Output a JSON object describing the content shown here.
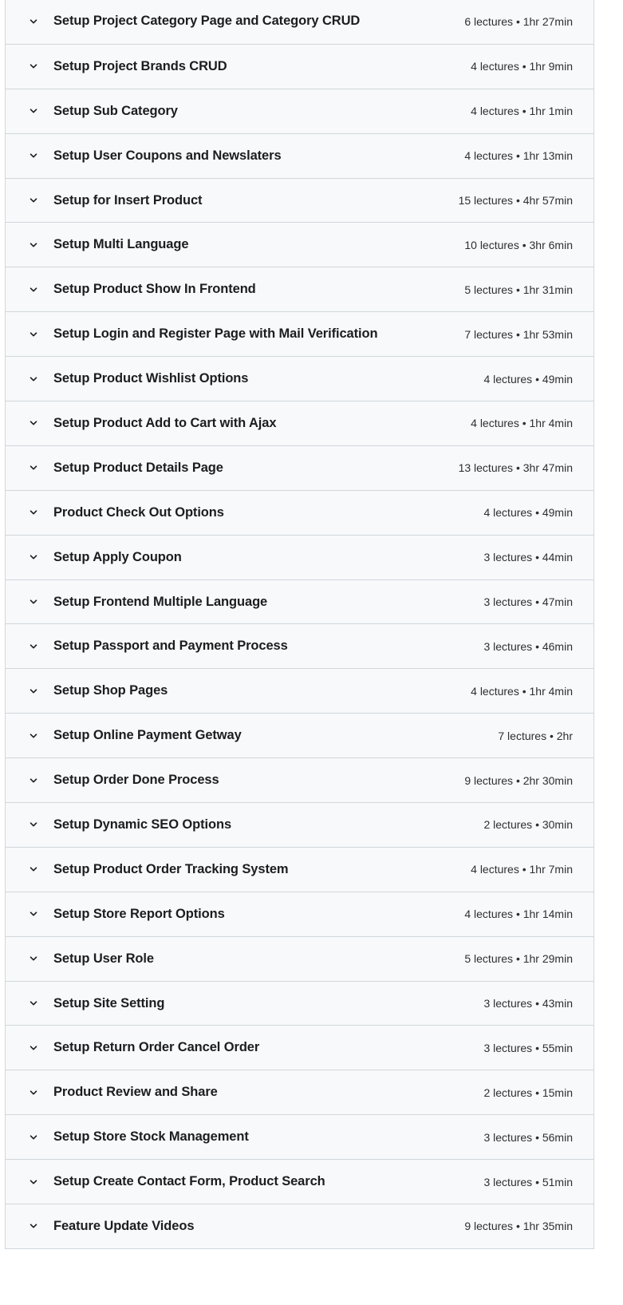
{
  "curriculum": {
    "sections": [
      {
        "title": "Setup Project Category Page and Category CRUD",
        "meta": "6 lectures • 1hr 27min"
      },
      {
        "title": "Setup Project Brands CRUD",
        "meta": "4 lectures • 1hr 9min"
      },
      {
        "title": "Setup Sub Category",
        "meta": "4 lectures • 1hr 1min"
      },
      {
        "title": "Setup User Coupons and Newslaters",
        "meta": "4 lectures • 1hr 13min"
      },
      {
        "title": "Setup for Insert Product",
        "meta": "15 lectures • 4hr 57min"
      },
      {
        "title": "Setup Multi Language",
        "meta": "10 lectures • 3hr 6min"
      },
      {
        "title": "Setup Product Show In Frontend",
        "meta": "5 lectures • 1hr 31min"
      },
      {
        "title": "Setup Login and Register Page with Mail Verification",
        "meta": "7 lectures • 1hr 53min"
      },
      {
        "title": "Setup Product Wishlist Options",
        "meta": "4 lectures • 49min"
      },
      {
        "title": "Setup Product Add to Cart with Ajax",
        "meta": "4 lectures • 1hr 4min"
      },
      {
        "title": "Setup Product Details Page",
        "meta": "13 lectures • 3hr 47min"
      },
      {
        "title": "Product Check Out Options",
        "meta": "4 lectures • 49min"
      },
      {
        "title": "Setup Apply Coupon",
        "meta": "3 lectures • 44min"
      },
      {
        "title": "Setup Frontend Multiple Language",
        "meta": "3 lectures • 47min"
      },
      {
        "title": "Setup Passport and Payment Process",
        "meta": "3 lectures • 46min"
      },
      {
        "title": "Setup Shop Pages",
        "meta": "4 lectures • 1hr 4min"
      },
      {
        "title": "Setup Online Payment Getway",
        "meta": "7 lectures • 2hr"
      },
      {
        "title": "Setup Order Done Process",
        "meta": "9 lectures • 2hr 30min"
      },
      {
        "title": "Setup Dynamic SEO Options",
        "meta": "2 lectures • 30min"
      },
      {
        "title": "Setup Product Order Tracking System",
        "meta": "4 lectures • 1hr 7min"
      },
      {
        "title": "Setup Store Report Options",
        "meta": "4 lectures • 1hr 14min"
      },
      {
        "title": "Setup User Role",
        "meta": "5 lectures • 1hr 29min"
      },
      {
        "title": "Setup Site Setting",
        "meta": "3 lectures • 43min"
      },
      {
        "title": "Setup Return Order Cancel Order",
        "meta": "3 lectures • 55min"
      },
      {
        "title": "Product Review and Share",
        "meta": "2 lectures • 15min"
      },
      {
        "title": "Setup Store Stock Management",
        "meta": "3 lectures • 56min"
      },
      {
        "title": "Setup Create Contact Form, Product Search",
        "meta": "3 lectures • 51min"
      },
      {
        "title": "Feature Update Videos",
        "meta": "9 lectures • 1hr 35min"
      }
    ],
    "icon": "chevron-down-icon"
  }
}
